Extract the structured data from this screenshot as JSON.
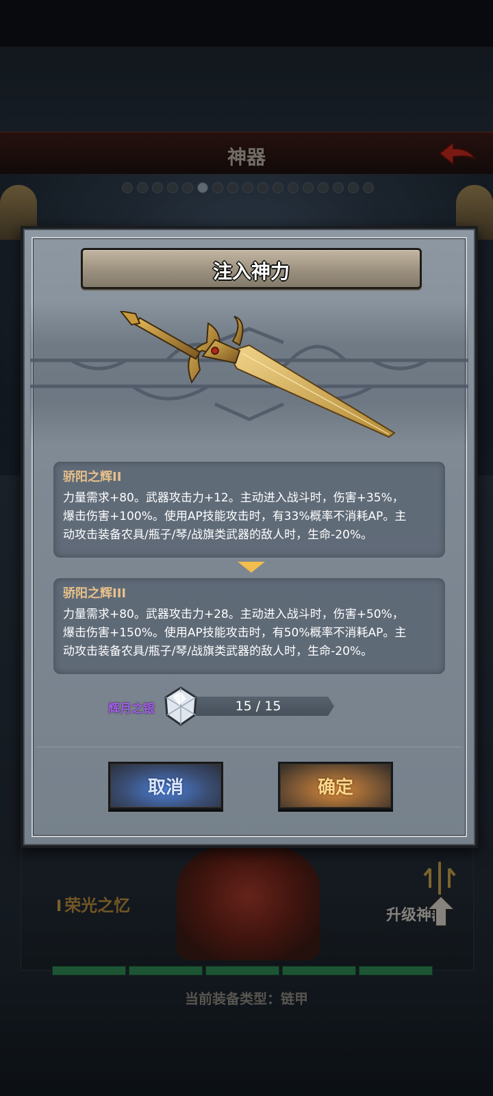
{
  "background": {
    "title": "神器",
    "memory_label": "荣光之忆",
    "memory_level": "I",
    "upgrade_label": "升级神器",
    "equip_type": "当前装备类型：链甲",
    "progress_segments": 5,
    "page_dots": 17,
    "active_dot": 5
  },
  "modal": {
    "title": "注入神力",
    "current": {
      "name": "骄阳之辉II",
      "desc_lines": [
        "力量需求+80。武器攻击力+12。主动进入战斗时，伤害+35%，",
        "爆击伤害+100%。使用AP技能攻击时，有33%概率不消耗AP。主",
        "动攻击装备农具/瓶子/琴/战旗类武器的敌人时，生命-20%。"
      ]
    },
    "next": {
      "name": "骄阳之辉III",
      "desc_lines": [
        "力量需求+80。武器攻击力+28。主动进入战斗时，伤害+50%，",
        "爆击伤害+150%。使用AP技能攻击时，有50%概率不消耗AP。主",
        "动攻击装备农具/瓶子/琴/战旗类武器的敌人时，生命-20%。"
      ]
    },
    "cost": {
      "label": "辉月之银",
      "amount": "15 / 15"
    },
    "buttons": {
      "cancel": "取消",
      "confirm": "确定"
    }
  },
  "colors": {
    "confirm_text": "#ffd68a",
    "cancel_text": "#dbe8ff",
    "item_name": "#e7c189",
    "cost_label": "#a15fe0",
    "arrow": "#f2bd4c"
  }
}
